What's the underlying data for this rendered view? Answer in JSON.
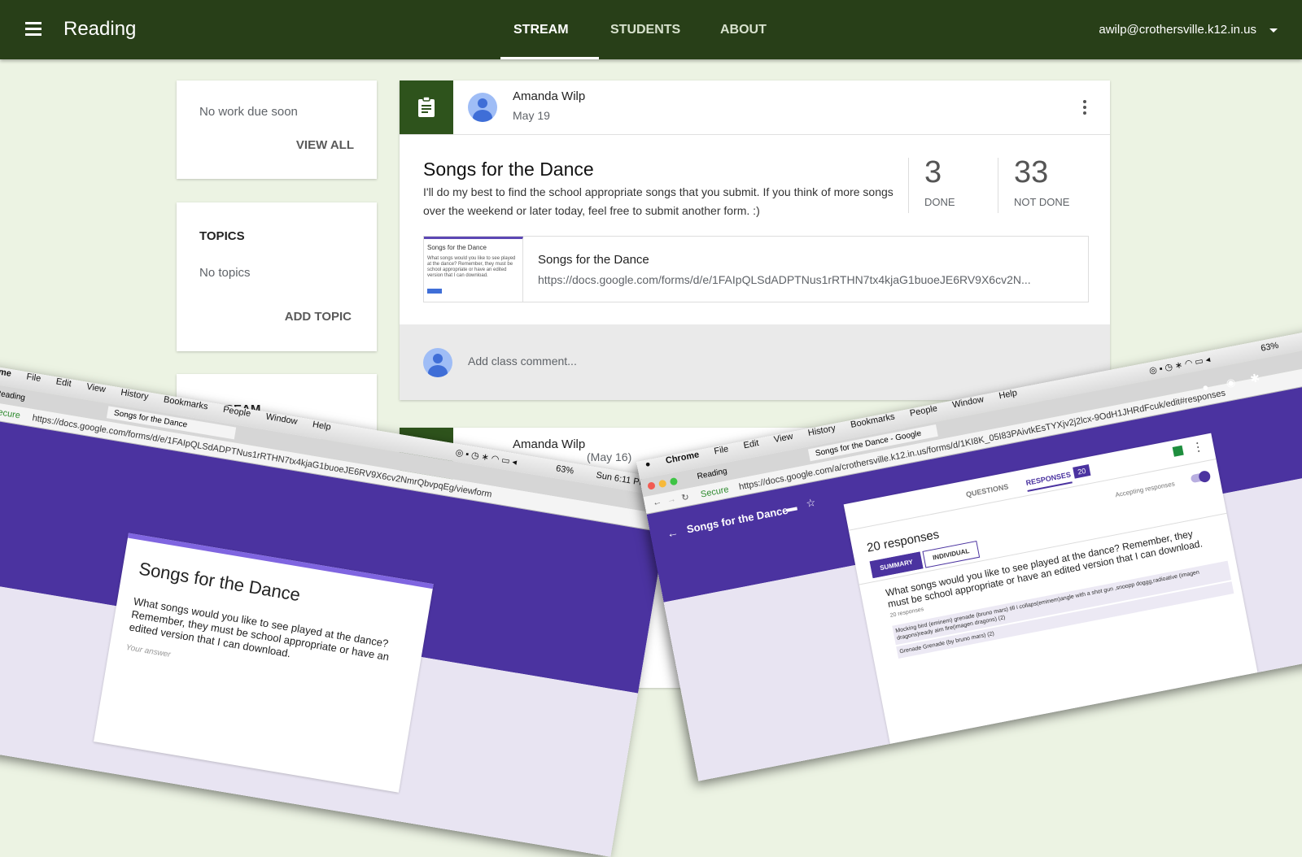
{
  "header": {
    "title": "Reading",
    "tabs": [
      {
        "label": "STREAM",
        "active": true
      },
      {
        "label": "STUDENTS",
        "active": false
      },
      {
        "label": "ABOUT",
        "active": false
      }
    ],
    "account": "awilp@crothersville.k12.in.us"
  },
  "sidebar": {
    "upcoming": {
      "text": "No work due soon",
      "action": "VIEW ALL"
    },
    "topics": {
      "heading": "TOPICS",
      "text": "No topics",
      "action": "ADD TOPIC"
    },
    "partial_heading": "STREAM"
  },
  "post": {
    "author": "Amanda Wilp",
    "date": "May 19",
    "title": "Songs for the Dance",
    "body": "I'll do my best to find the school appropriate songs that you submit. If you think of more songs over the weekend or later today, feel free to submit another form. :)",
    "done_count": "3",
    "done_label": "DONE",
    "not_done_count": "33",
    "not_done_label": "NOT DONE",
    "attachment": {
      "title": "Songs for the Dance",
      "url": "https://docs.google.com/forms/d/e/1FAIpQLSdADPTNus1rRTHN7tx4kjaG1buoeJE6RV9X6cv2N...",
      "thumb_title": "Songs for the Dance",
      "thumb_text": "What songs would you like to see played at the dance? Remember, they must be school appropriate or have an edited version that I can download."
    },
    "comment_placeholder": "Add class comment..."
  },
  "post2": {
    "author": "Amanda Wilp",
    "date_partial": "(May 16)"
  },
  "overlay_left": {
    "menubar": [
      "Chrome",
      "File",
      "Edit",
      "View",
      "History",
      "Bookmarks",
      "People",
      "Window",
      "Help"
    ],
    "tabs": [
      "Reading",
      "Songs for the Dance"
    ],
    "secure": "Secure",
    "url": "https://docs.google.com/forms/d/e/1FAIpQLSdADPTNus1rRTHN7tx4kjaG1buoeJE6RV9X6cv2NmrQbvpqEg/viewform",
    "status": {
      "battery": "63%",
      "clock": "Sun 6:11 PM"
    },
    "form_title": "Songs for the Dance",
    "question": "What songs would you like to see played at the dance? Remember, they must be school appropriate or have an edited version that I can download.",
    "answer_placeholder": "Your answer"
  },
  "overlay_right": {
    "menubar": [
      "Chrome",
      "File",
      "Edit",
      "View",
      "History",
      "Bookmarks",
      "People",
      "Window",
      "Help"
    ],
    "tabs": [
      "Reading",
      "Songs for the Dance - Google"
    ],
    "secure": "Secure",
    "url": "https://docs.google.com/a/crothersville.k12.in.us/forms/d/1KI8K_05I83PAivtkEsTYXjv2j2lcx-9OdH1JHRdFcuk/edit#responses",
    "status": {
      "battery": "63%"
    },
    "form_title": "Songs for the Dance",
    "tab_questions": "QUESTIONS",
    "tab_responses": "RESPONSES",
    "responses_badge": "20",
    "responses_heading": "20 responses",
    "accepting": "Accepting responses",
    "summary": "SUMMARY",
    "individual": "INDIVIDUAL",
    "question": "What songs would you like to see played at the dance? Remember, they must be school appropriate or have an edited version that I can download.",
    "question_count": "20 responses",
    "answers": [
      "Mocking bird (eminem) grenade (bruno mars) till i collaps(eminem)angle with a shot gun ,snoopp doggg,radioative (imagen dragons)ready aim fire(imagen dragons) (2)",
      "Grenade Grenade (by bruno mars) (2)"
    ]
  }
}
